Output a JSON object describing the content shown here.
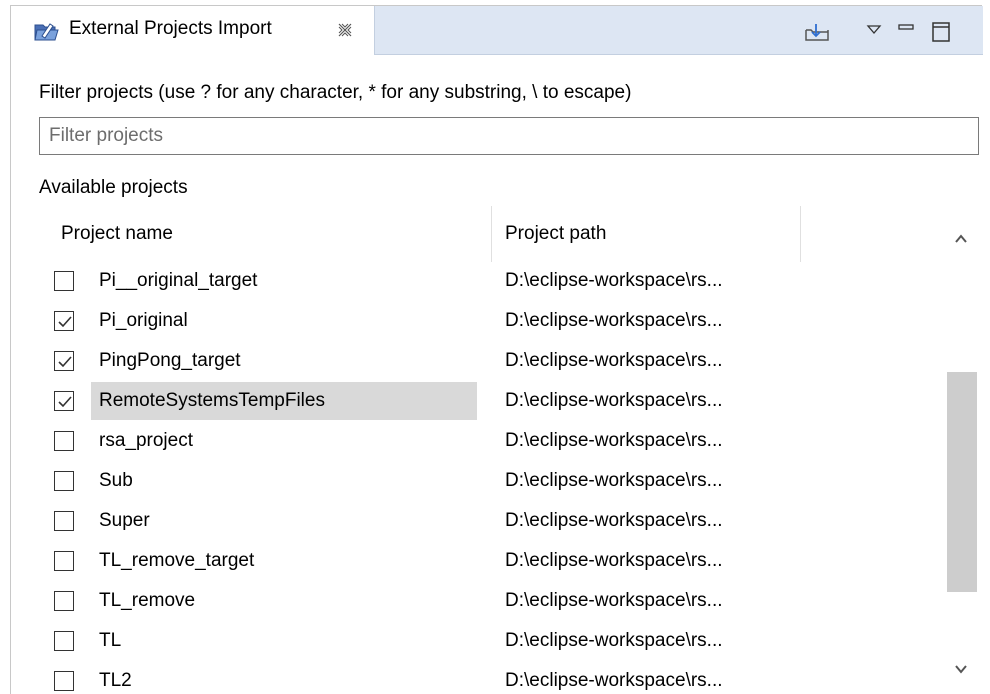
{
  "tab": {
    "title": "External Projects Import",
    "icon": "project-import-icon"
  },
  "filter": {
    "label": "Filter projects (use ? for any character, * for any substring, \\ to escape)",
    "placeholder": "Filter projects",
    "value": ""
  },
  "available_label": "Available projects",
  "table": {
    "columns": [
      "Project name",
      "Project path"
    ],
    "rows": [
      {
        "name": "Pi__original_target",
        "path": "D:\\eclipse-workspace\\rs...",
        "checked": false,
        "selected": false
      },
      {
        "name": "Pi_original",
        "path": "D:\\eclipse-workspace\\rs...",
        "checked": true,
        "selected": false
      },
      {
        "name": "PingPong_target",
        "path": "D:\\eclipse-workspace\\rs...",
        "checked": true,
        "selected": false
      },
      {
        "name": "RemoteSystemsTempFiles",
        "path": "D:\\eclipse-workspace\\rs...",
        "checked": true,
        "selected": true
      },
      {
        "name": "rsa_project",
        "path": "D:\\eclipse-workspace\\rs...",
        "checked": false,
        "selected": false
      },
      {
        "name": "Sub",
        "path": "D:\\eclipse-workspace\\rs...",
        "checked": false,
        "selected": false
      },
      {
        "name": "Super",
        "path": "D:\\eclipse-workspace\\rs...",
        "checked": false,
        "selected": false
      },
      {
        "name": "TL_remove_target",
        "path": "D:\\eclipse-workspace\\rs...",
        "checked": false,
        "selected": false
      },
      {
        "name": "TL_remove",
        "path": "D:\\eclipse-workspace\\rs...",
        "checked": false,
        "selected": false
      },
      {
        "name": "TL",
        "path": "D:\\eclipse-workspace\\rs...",
        "checked": false,
        "selected": false
      },
      {
        "name": "TL2",
        "path": "D:\\eclipse-workspace\\rs...",
        "checked": false,
        "selected": false
      }
    ]
  },
  "colors": {
    "tabbar_bg": "#dde6f3",
    "selection_bg": "#d9d9d9",
    "scroll_thumb": "#cdcdcd"
  }
}
